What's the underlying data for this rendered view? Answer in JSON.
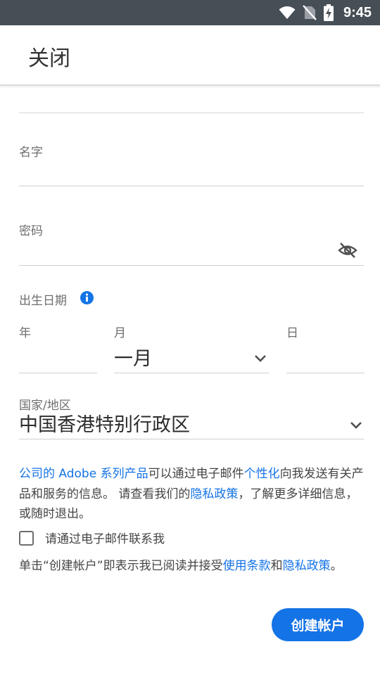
{
  "status_bar": {
    "time": "9:45"
  },
  "app_bar": {
    "close_label": "关闭"
  },
  "form": {
    "name_label": "名字",
    "password_label": "密码",
    "birthdate": {
      "label": "出生日期",
      "year_label": "年",
      "month_label": "月",
      "month_value": "一月",
      "day_label": "日"
    },
    "country": {
      "label": "国家/地区",
      "value": "中国香港特别行政区"
    }
  },
  "consent": {
    "company_link": "公司的 Adobe 系列产品",
    "text_1": "可以通过电子邮件",
    "personalize_link": "个性化",
    "text_2": "向我发送有关产品和服务的信息。 请查看我们的",
    "privacy_link": "隐私政策",
    "text_3": "，了解更多详细信息，或随时退出。"
  },
  "email_checkbox": {
    "label": "请通过电子邮件联系我",
    "checked": false
  },
  "terms": {
    "text_1": "单击“创建帐户”即表示我已阅读并接受",
    "terms_link": "使用条款",
    "text_2": "和",
    "privacy_link": "隐私政策",
    "text_3": "。"
  },
  "create_button_label": "创建帐户",
  "colors": {
    "accent": "#1473e6",
    "status_bar": "#474f56"
  }
}
